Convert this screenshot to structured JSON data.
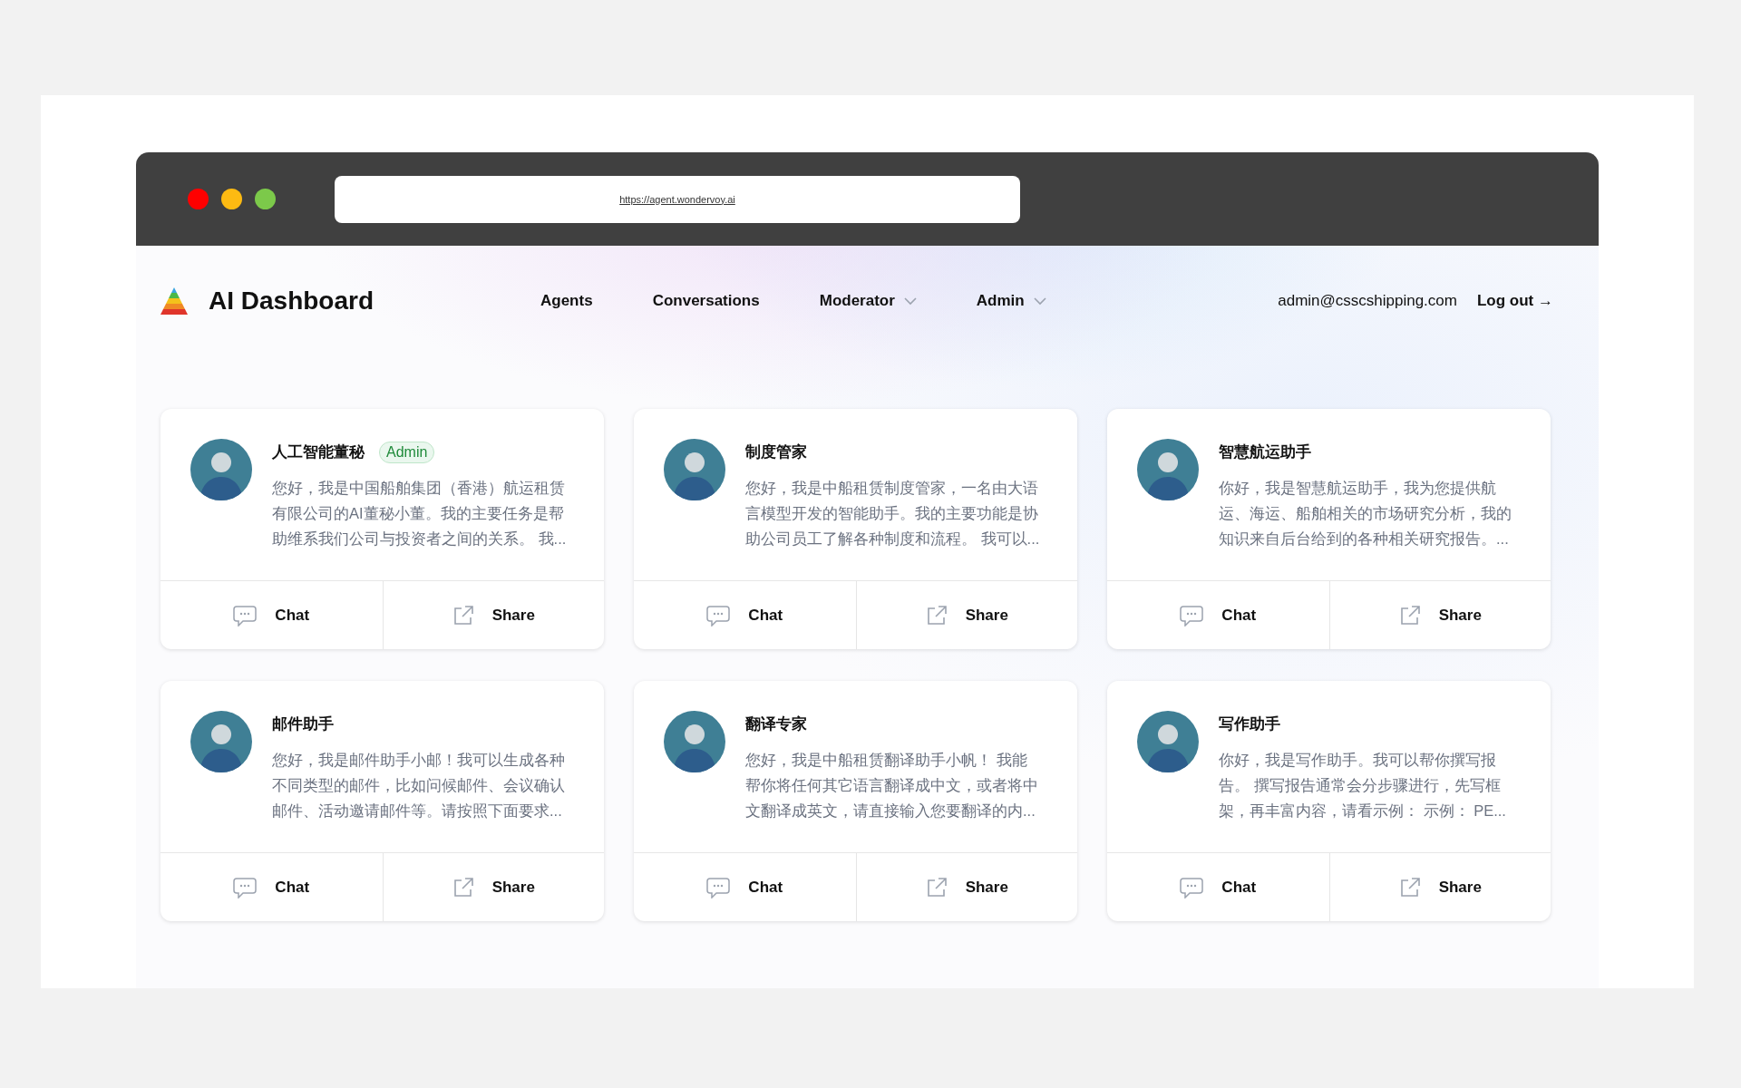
{
  "browser": {
    "url": "https://agent.wondervoy.ai"
  },
  "header": {
    "title": "AI Dashboard",
    "nav": [
      {
        "label": "Agents",
        "kind": "link"
      },
      {
        "label": "Conversations",
        "kind": "link"
      },
      {
        "label": "Moderator",
        "kind": "dropdown"
      },
      {
        "label": "Admin",
        "kind": "dropdown"
      }
    ],
    "user_email": "admin@csscshipping.com",
    "logout": "Log out →"
  },
  "agents": [
    {
      "name": "人工智能董秘",
      "badge": "Admin",
      "description_lines": [
        "您好，我是中国船舶集团（香港）航运租赁",
        "有限公司的AI董秘小董。我的主要任务是帮",
        "助维系我们公司与投资者之间的关系。 我..."
      ],
      "actions": [
        "Chat",
        "Share"
      ]
    },
    {
      "name": "制度管家",
      "description_lines": [
        "您好，我是中船租赁制度管家，一名由大语",
        "言模型开发的智能助手。我的主要功能是协",
        "助公司员工了解各种制度和流程。 我可以..."
      ],
      "actions": [
        "Chat",
        "Share"
      ]
    },
    {
      "name": "智慧航运助手",
      "description_lines": [
        "你好，我是智慧航运助手，我为您提供航",
        "运、海运、船舶相关的市场研究分析，我的",
        "知识来自后台给到的各种相关研究报告。..."
      ],
      "actions": [
        "Chat",
        "Share"
      ]
    },
    {
      "name": "邮件助手",
      "description_lines": [
        "您好，我是邮件助手小邮！我可以生成各种",
        "不同类型的邮件，比如问候邮件、会议确认",
        "邮件、活动邀请邮件等。请按照下面要求..."
      ],
      "actions": [
        "Chat",
        "Share"
      ]
    },
    {
      "name": "翻译专家",
      "description_lines": [
        "您好，我是中船租赁翻译助手小帆！ 我能",
        "帮你将任何其它语言翻译成中文，或者将中",
        "文翻译成英文，请直接输入您要翻译的内..."
      ],
      "actions": [
        "Chat",
        "Share"
      ]
    },
    {
      "name": "写作助手",
      "description_lines": [
        "你好，我是写作助手。我可以帮你撰写报",
        "告。 撰写报告通常会分步骤进行，先写框",
        "架，再丰富内容，请看示例： 示例： PE..."
      ],
      "actions": [
        "Chat",
        "Share"
      ]
    }
  ]
}
